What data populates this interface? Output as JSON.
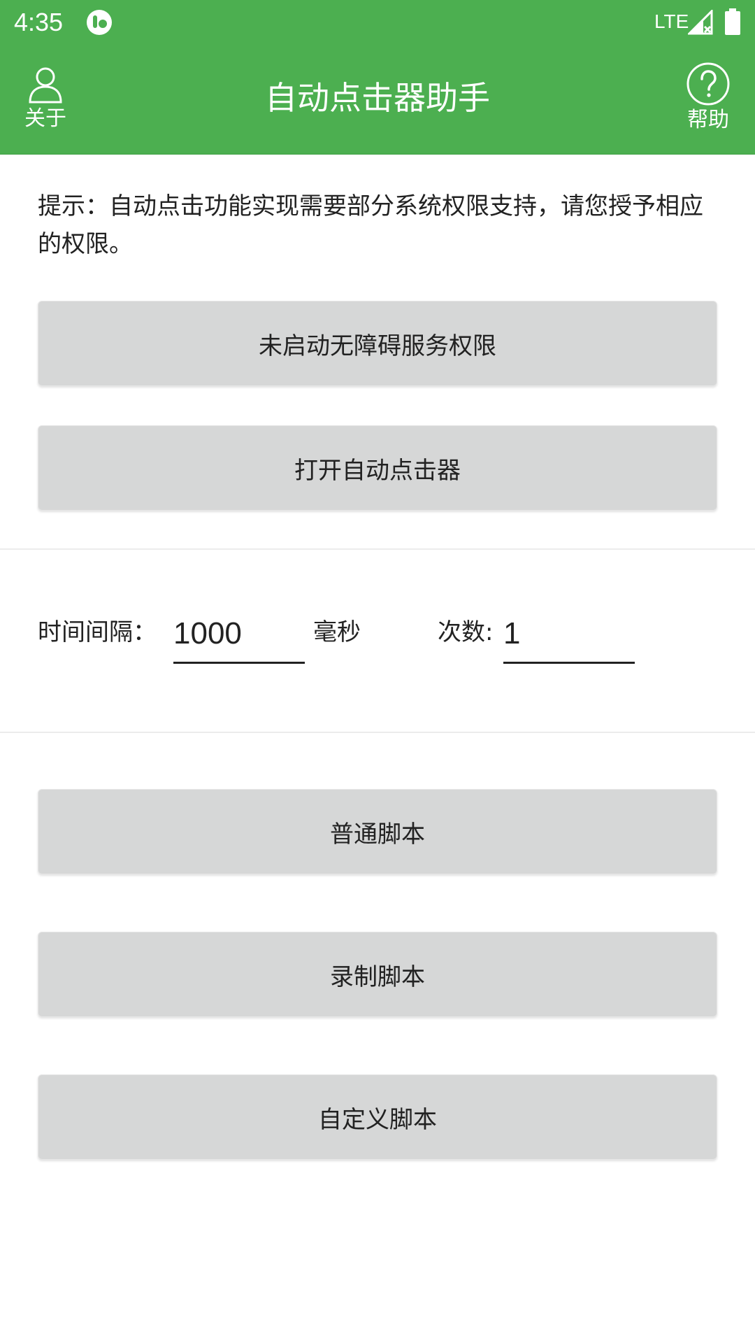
{
  "statusbar": {
    "time": "4:35",
    "network": "LTE",
    "icons": [
      "app-notification-icon",
      "signal-icon",
      "battery-icon"
    ]
  },
  "appbar": {
    "title": "自动点击器助手",
    "left_label": "关于",
    "left_icon": "person-icon",
    "right_label": "帮助",
    "right_icon": "help-circle-icon"
  },
  "tip": "提示：自动点击功能实现需要部分系统权限支持，请您授予相应的权限。",
  "buttons": {
    "accessibility": "未启动无障碍服务权限",
    "open_clicker": "打开自动点击器",
    "normal_script": "普通脚本",
    "record_script": "录制脚本",
    "custom_script": "自定义脚本"
  },
  "settings": {
    "interval_label": "时间间隔：",
    "interval_value": "1000",
    "interval_unit": "毫秒",
    "count_label": "次数:",
    "count_value": "1"
  },
  "colors": {
    "primary": "#4CAF50",
    "button_bg": "#d6d7d7",
    "text": "#222222"
  }
}
